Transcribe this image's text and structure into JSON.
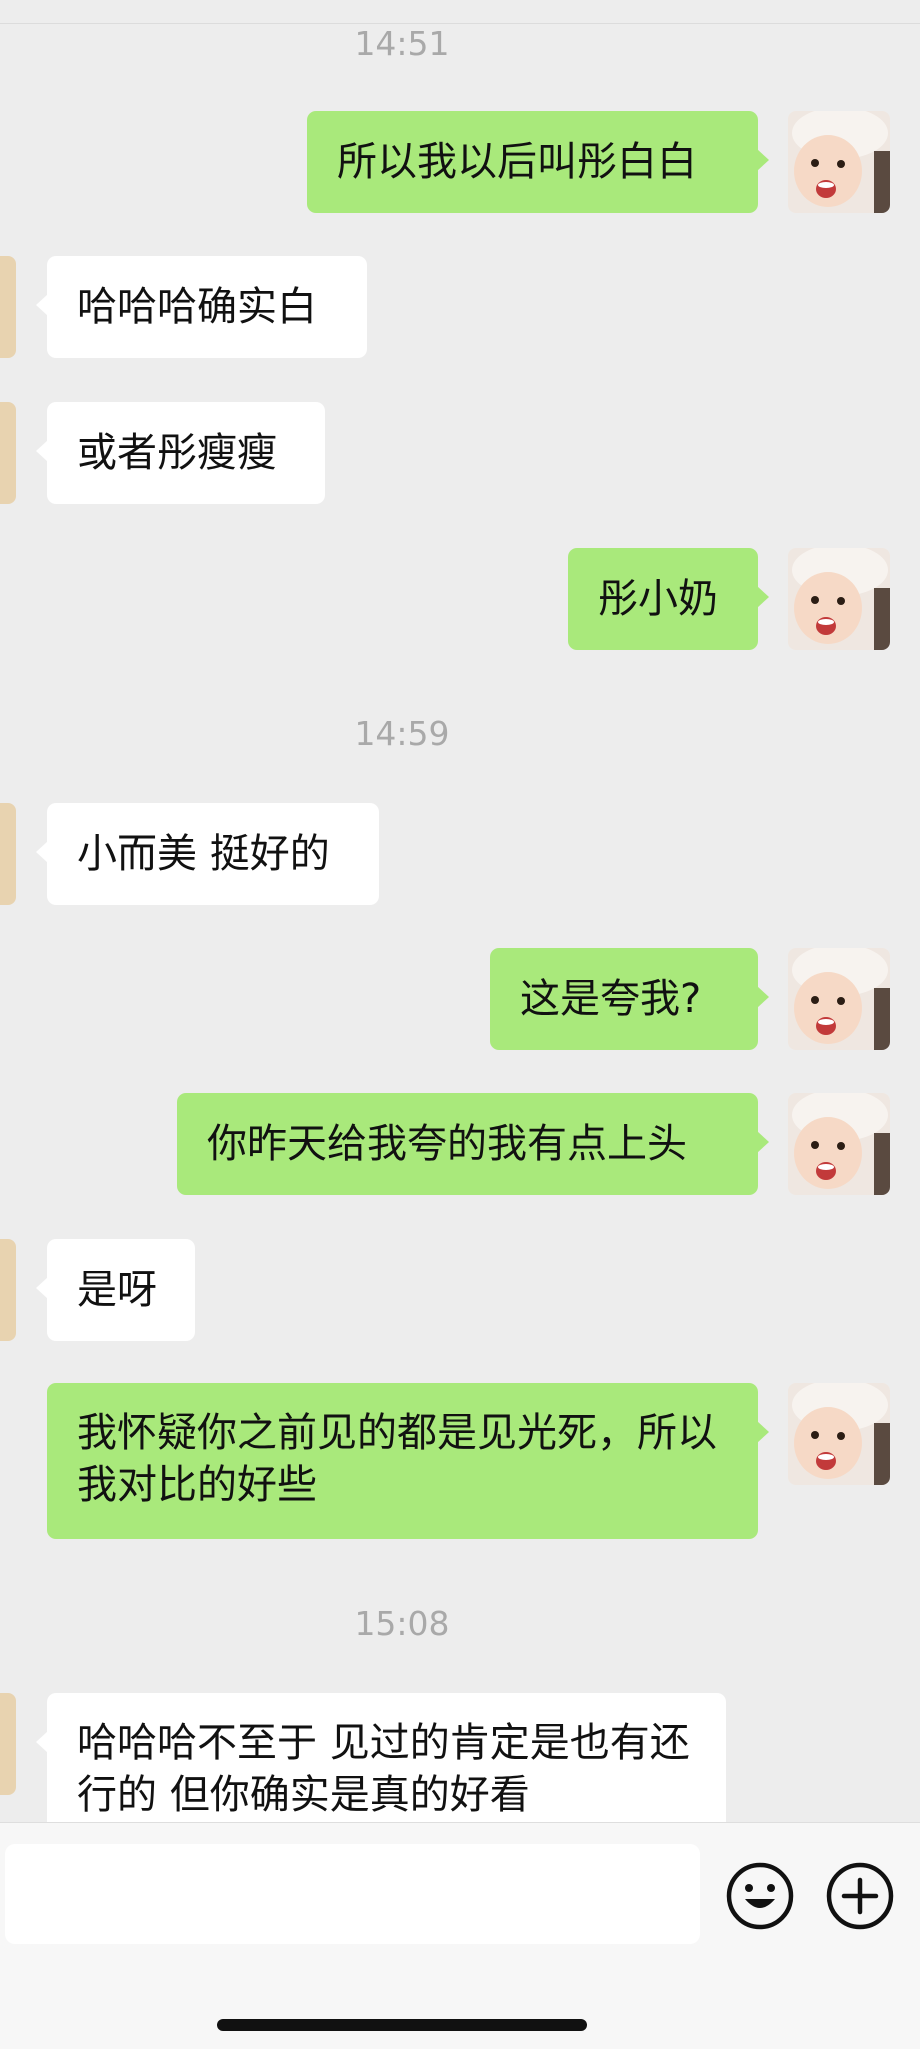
{
  "chat": {
    "timestamps": [
      "14:51",
      "14:59",
      "15:08"
    ],
    "messages": [
      {
        "sender": "me",
        "text": "所以我以后叫彤白白"
      },
      {
        "sender": "them",
        "text": "哈哈哈确实白"
      },
      {
        "sender": "them",
        "text": "或者彤瘦瘦"
      },
      {
        "sender": "me",
        "text": "彤小奶"
      },
      {
        "sender": "them",
        "text": "小而美 挺好的"
      },
      {
        "sender": "me",
        "text": "这是夸我?"
      },
      {
        "sender": "me",
        "text": "你昨天给我夸的我有点上头"
      },
      {
        "sender": "them",
        "text": "是呀"
      },
      {
        "sender": "me",
        "text": "我怀疑你之前见的都是见光死，所以我对比的好些"
      },
      {
        "sender": "them",
        "text": "哈哈哈不至于 见过的肯定是也有还行的 但你确实是真的好看"
      }
    ]
  },
  "input_bar": {
    "text_field_value": "",
    "emoji_icon": "emoji-icon",
    "add_icon": "plus-circle-icon"
  },
  "colors": {
    "background": "#ededed",
    "my_bubble": "#a9e97b",
    "their_bubble": "#ffffff",
    "timestamp_text": "#a9a9a9"
  }
}
